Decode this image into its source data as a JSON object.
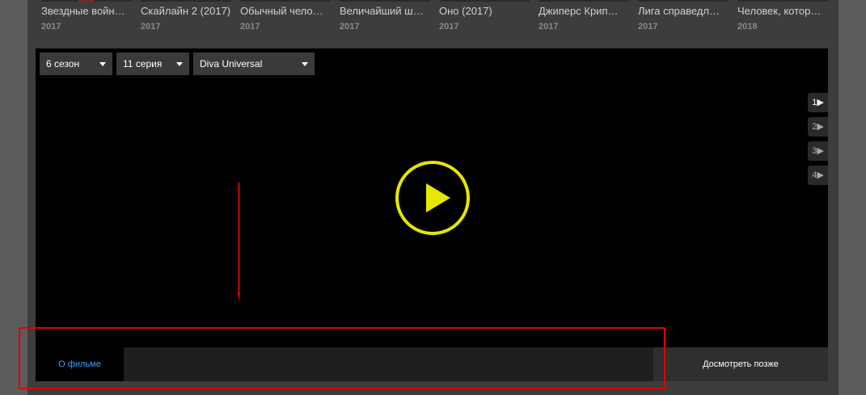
{
  "related": [
    {
      "title": "Звездные войн…",
      "year": "2017"
    },
    {
      "title": "Скайлайн 2 (2017)",
      "year": "2017"
    },
    {
      "title": "Обычный чело…",
      "year": "2017"
    },
    {
      "title": "Величайший ш…",
      "year": "2017"
    },
    {
      "title": "Оно (2017)",
      "year": "2017"
    },
    {
      "title": "Джиперс Крип…",
      "year": "2017"
    },
    {
      "title": "Лига справедл…",
      "year": "2017"
    },
    {
      "title": "Человек, котор…",
      "year": "2018"
    }
  ],
  "player": {
    "season": "6 сезон",
    "episode": "11 серия",
    "voice": "Diva Universal",
    "parts": [
      "1▶",
      "2▶",
      "3▶",
      "4▶"
    ],
    "active_part_index": 0,
    "play_color": "#e6e600"
  },
  "bottom": {
    "about_tab": "О фильме",
    "watch_later": "Досмотреть позже"
  },
  "annotation": {
    "color": "#e00000"
  }
}
